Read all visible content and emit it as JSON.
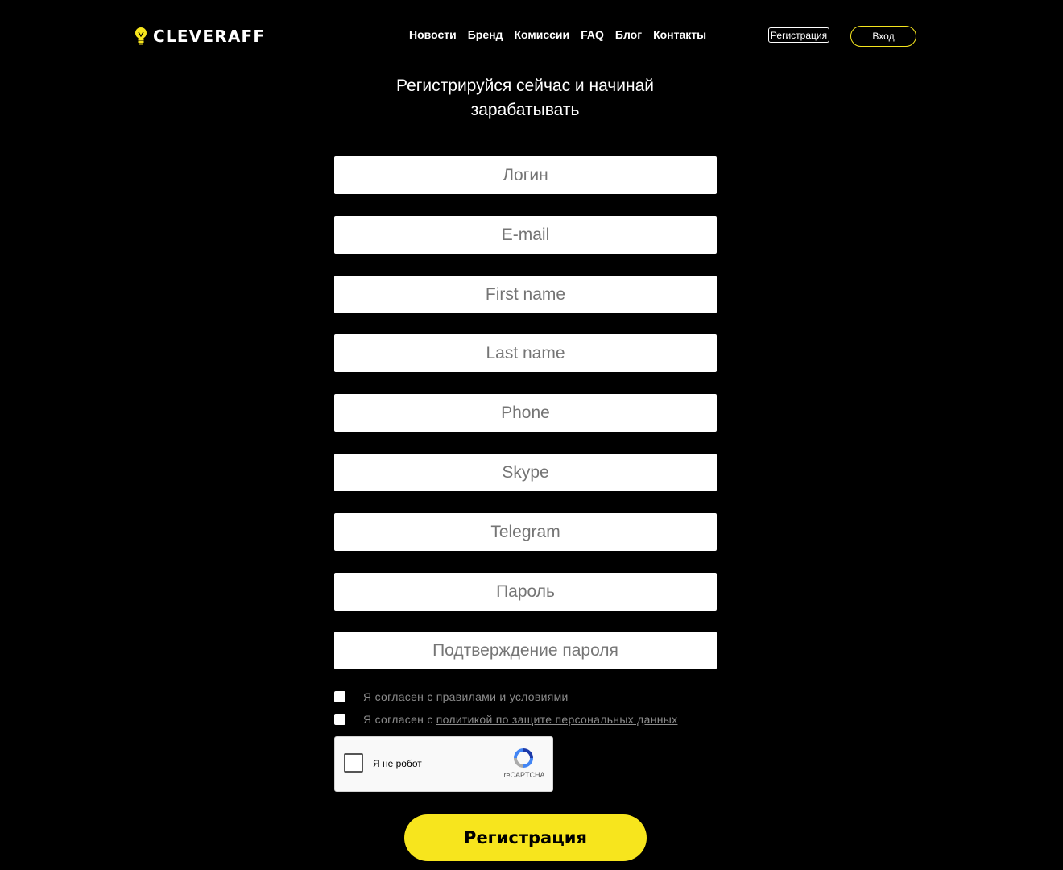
{
  "header": {
    "logo_text": "CLEVERAFF",
    "logo_icon": "lightbulb-icon",
    "nav": [
      {
        "label": "Новости"
      },
      {
        "label": "Бренд"
      },
      {
        "label": "Комиссии"
      },
      {
        "label": "FAQ"
      },
      {
        "label": "Блог"
      },
      {
        "label": "Контакты"
      }
    ],
    "register_label": "Регистрация",
    "login_label": "Вход"
  },
  "colors": {
    "background": "#000000",
    "accent": "#f7e51d",
    "text": "#ffffff"
  },
  "heading": {
    "line1": "Регистрируйся сейчас и начинай",
    "line2": "зарабатывать"
  },
  "form": {
    "fields": [
      {
        "placeholder": "Логин",
        "value": ""
      },
      {
        "placeholder": "E-mail",
        "value": ""
      },
      {
        "placeholder": "First name",
        "value": ""
      },
      {
        "placeholder": "Last name",
        "value": ""
      },
      {
        "placeholder": "Phone",
        "value": ""
      },
      {
        "placeholder": "Skype",
        "value": ""
      },
      {
        "placeholder": "Telegram",
        "value": ""
      },
      {
        "placeholder": "Пароль",
        "value": ""
      },
      {
        "placeholder": "Подтверждение пароля",
        "value": ""
      }
    ],
    "agreements": [
      {
        "text": "Я согласен с",
        "link": "правилами и условиями",
        "checked": false
      },
      {
        "text": "Я согласен с",
        "link": "политикой по защите персональных данных",
        "checked": false
      }
    ],
    "captcha": {
      "label": "Я не робот",
      "brand": "reCAPTCHA",
      "icon": "recaptcha-icon"
    },
    "submit_label": "Регистрация"
  }
}
